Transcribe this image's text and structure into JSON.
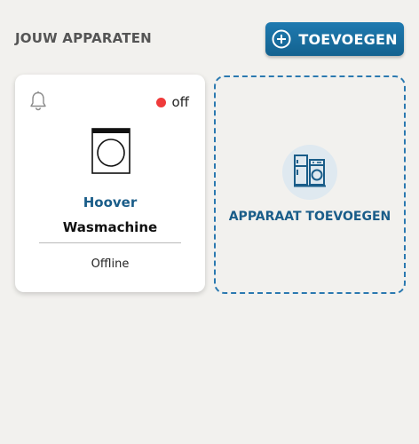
{
  "header": {
    "title": "JOUW APPARATEN",
    "add_button_label": "TOEVOEGEN"
  },
  "devices": [
    {
      "brand": "Hoover",
      "name": "Wasmachine",
      "status": "off",
      "connection": "Offline",
      "icon": "washing-machine-icon",
      "status_color": "#ef3b3b"
    }
  ],
  "add_card": {
    "label": "APPARAAT TOEVOEGEN",
    "icon": "appliances-icon"
  },
  "colors": {
    "accent": "#1a5d89",
    "button": "#1b6fa2",
    "background": "#f2f1ee",
    "status_off": "#ef3b3b"
  }
}
